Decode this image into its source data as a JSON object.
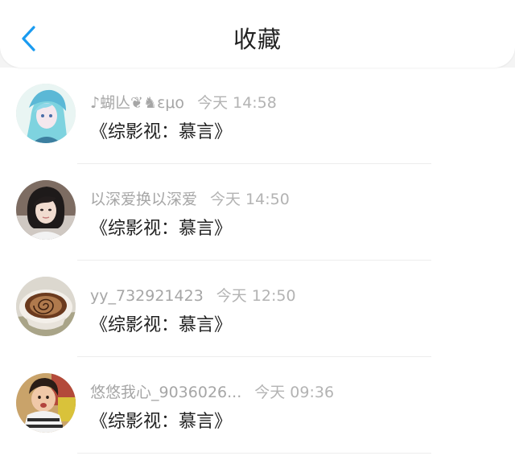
{
  "header": {
    "title": "收藏",
    "back_icon": "chevron-left-icon",
    "accent_color": "#1a9bf0"
  },
  "favorites": [
    {
      "username": "♪蝴亾❦♞ɛμο",
      "time": "今天 14:58",
      "title": "《综影视：慕言》",
      "avatar": "anime-character-avatar"
    },
    {
      "username": "以深爱换以深爱",
      "time": "今天 14:50",
      "title": "《综影视：慕言》",
      "avatar": "portrait-photo-avatar"
    },
    {
      "username": "yy_732921423",
      "time": "今天 12:50",
      "title": "《综影视：慕言》",
      "avatar": "coffee-cup-avatar"
    },
    {
      "username": "悠悠我心_9036026...",
      "time": "今天 09:36",
      "title": "《综影视：慕言》",
      "avatar": "child-photo-avatar"
    }
  ]
}
